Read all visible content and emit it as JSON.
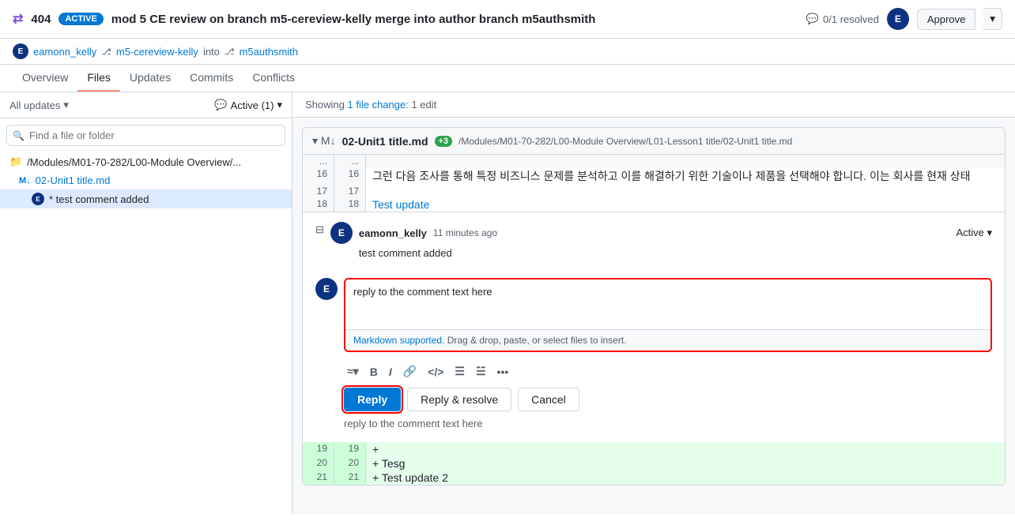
{
  "header": {
    "pr_icon": "⇄",
    "pr_number": "404",
    "active_badge": "ACTIVE",
    "pr_title": "mod 5 CE review on branch m5-cereview-kelly merge into author branch m5authsmith",
    "resolved_text": "0/1 resolved",
    "approve_label": "Approve"
  },
  "sub_header": {
    "avatar_letter": "E",
    "author": "eamonn_kelly",
    "branch_from": "m5-cereview-kelly",
    "into_text": "into",
    "branch_to": "m5authsmith"
  },
  "nav": {
    "tabs": [
      {
        "label": "Overview",
        "active": false
      },
      {
        "label": "Files",
        "active": true
      },
      {
        "label": "Updates",
        "active": false
      },
      {
        "label": "Commits",
        "active": false
      },
      {
        "label": "Conflicts",
        "active": false
      }
    ]
  },
  "sidebar": {
    "filter_label": "All updates",
    "active_label": "Active (1)",
    "search_placeholder": "Find a file or folder",
    "folder_path": "/Modules/M01-70-282/L00-Module Overview/...",
    "file_name": "02-Unit1 title.md",
    "comment_text": "* test comment added",
    "comment_avatar": "E"
  },
  "content": {
    "showing_text": "Showing",
    "file_change_count": "1 file change:",
    "edit_count": "1 edit",
    "file": {
      "name": "02-Unit1 title.md",
      "added_count": "+3",
      "path": "/Modules/M01-70-282/L00-Module Overview/L01-Lesson1 title/02-Unit1 title.md"
    },
    "diff_lines": [
      {
        "left_num": "...",
        "right_num": "...",
        "content": ""
      },
      {
        "left_num": "16",
        "right_num": "16",
        "content": "그런 다음 조사를 통해 특정 비즈니스 문제를 분석하고 이를 해결하기 위한 기술이나 제품을 선택해야 합니다. 이는 회사를 현재 상태"
      },
      {
        "left_num": "17",
        "right_num": "17",
        "content": ""
      },
      {
        "left_num": "18",
        "right_num": "18",
        "content": "Test update",
        "is_link": true
      }
    ],
    "comment": {
      "avatar_letter": "E",
      "username": "eamonn_kelly",
      "time": "11 minutes ago",
      "status": "Active",
      "body": "test comment added"
    },
    "reply": {
      "avatar_letter": "E",
      "placeholder": "reply to the comment text here",
      "textarea_value": "reply to the comment text here",
      "markdown_label": "Markdown supported.",
      "drag_text": " Drag & drop, paste, or select files to insert.",
      "btn_reply": "Reply",
      "btn_resolve": "Reply & resolve",
      "btn_cancel": "Cancel"
    },
    "preview_text": "reply to the comment text here",
    "added_lines": [
      {
        "left_num": "19",
        "right_num": "19",
        "content": "+",
        "added": true
      },
      {
        "left_num": "20",
        "right_num": "20",
        "content": "+ Tesg",
        "added": true
      },
      {
        "left_num": "21",
        "right_num": "21",
        "content": "+ Test update 2",
        "added": true
      }
    ]
  }
}
